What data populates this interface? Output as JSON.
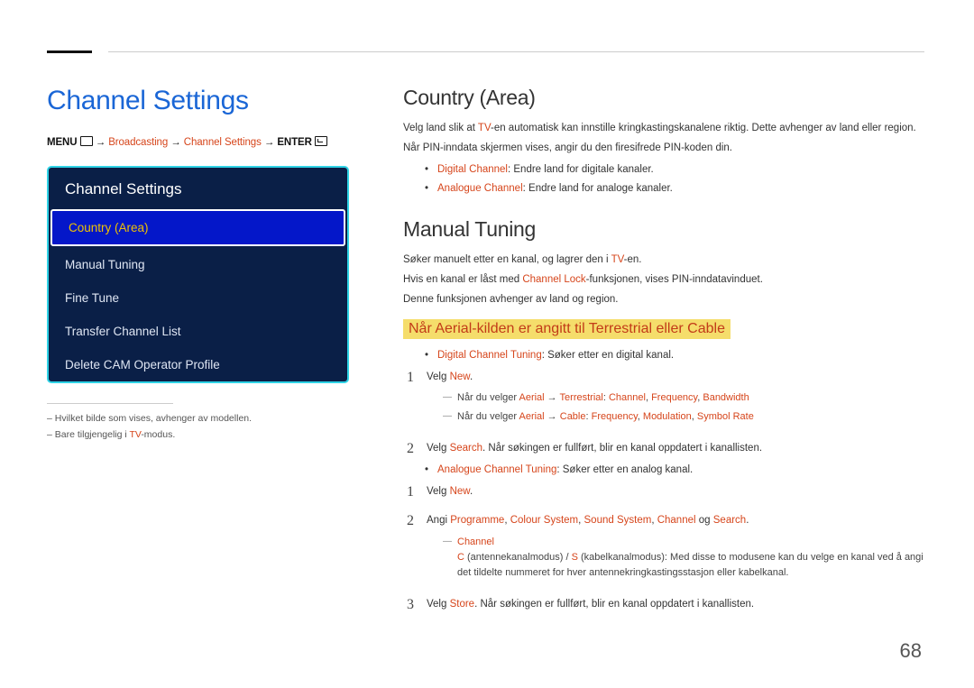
{
  "page_number": "68",
  "left": {
    "title": "Channel Settings",
    "path": {
      "menu": "MENU",
      "broadcasting": "Broadcasting",
      "channel_settings": "Channel Settings",
      "enter": "ENTER"
    },
    "panel": {
      "title": "Channel Settings",
      "items": [
        "Country (Area)",
        "Manual Tuning",
        "Fine Tune",
        "Transfer Channel List",
        "Delete CAM Operator Profile"
      ]
    },
    "notes": {
      "0": "Hvilket bilde som vises, avhenger av modellen.",
      "1a": "Bare tilgjengelig i",
      "1b": "TV",
      "1c": "-modus."
    }
  },
  "right": {
    "country": {
      "heading": "Country (Area)",
      "p1a": "Velg land slik at",
      "tv": "TV",
      "p1b": "-en automatisk kan innstille kringkastingskanalene riktig. Dette avhenger av land eller region.",
      "p2": "Når PIN-inndata skjermen vises, angir du den firesifrede PIN-koden din.",
      "b1": {
        "term": "Digital Channel",
        "rest": ": Endre land for digitale kanaler."
      },
      "b2": {
        "term": "Analogue Channel",
        "rest": ": Endre land for analoge kanaler."
      }
    },
    "manual": {
      "heading": "Manual Tuning",
      "p1a": "Søker manuelt etter en kanal, og lagrer den i",
      "tv": "TV",
      "p1b": "-en.",
      "p2a": "Hvis en kanal er låst med",
      "lock": "Channel Lock",
      "p2b": "-funksjonen, vises PIN-inndatavinduet.",
      "p3": "Denne funksjonen avhenger av land og region."
    },
    "sub": {
      "heading": "Når Aerial-kilden er angitt til Terrestrial eller Cable",
      "b1": {
        "term": "Digital Channel Tuning",
        "rest": ": Søker etter en digital kanal."
      },
      "b2": {
        "term": "Analogue Channel Tuning",
        "rest": ": Søker etter en analog kanal."
      },
      "d": [
        {
          "n": "1",
          "a": "Velg",
          "b": "New",
          "c": ".",
          "dash1": {
            "a": "Når du velger",
            "b": "Aerial",
            "c": "Terrestrial",
            "d": "Channel",
            "e": "Frequency",
            "f": "Bandwidth"
          },
          "dash2": {
            "a": "Når du velger",
            "b": "Aerial",
            "c": "Cable",
            "d": "Frequency",
            "e": "Modulation",
            "f": "Symbol Rate"
          }
        },
        {
          "n": "2",
          "a": "Velg",
          "b": "Search",
          "c": ". Når søkingen er fullført, blir en kanal oppdatert i kanallisten."
        }
      ],
      "a": [
        {
          "n": "1",
          "a": "Velg",
          "b": "New",
          "c": "."
        },
        {
          "n": "2",
          "a": "Angi",
          "b": "Programme",
          "c": "Colour System",
          "d": "Sound System",
          "e": "Channel",
          "f": "og",
          "g": "Search",
          "h": ".",
          "dash": {
            "title": "Channel",
            "c": "C",
            "cdesc": "(antennekanalmodus)",
            "s": "S",
            "sdesc": "(kabelkanalmodus): Med disse to modusene kan du velge en kanal ved å angi det tildelte nummeret for hver antennekringkastingsstasjon eller kabelkanal."
          }
        },
        {
          "n": "3",
          "a": "Velg",
          "b": "Store",
          "c": ". Når søkingen er fullført, blir en kanal oppdatert i kanallisten."
        }
      ]
    }
  }
}
